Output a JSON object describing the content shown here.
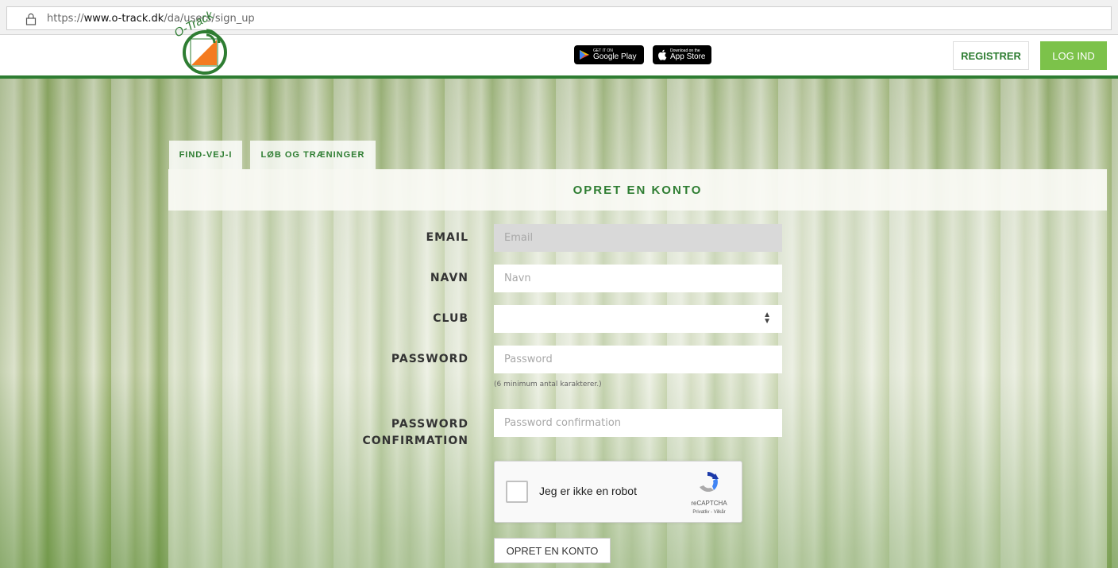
{
  "browser": {
    "url_prefix": "https://",
    "url_domain": "www.o-track.dk",
    "url_path": "/da/users/sign_up"
  },
  "header": {
    "logo_text": "O-Track",
    "google_play_small": "GET IT ON",
    "google_play_big": "Google Play",
    "app_store_small": "Download on the",
    "app_store_big": "App Store",
    "register_label": "REGISTRER",
    "login_label": "LOG IND"
  },
  "tabs": [
    {
      "label": "FIND-VEJ-I"
    },
    {
      "label": "LØB OG TRÆNINGER"
    }
  ],
  "form": {
    "title": "OPRET EN KONTO",
    "email_label": "EMAIL",
    "email_placeholder": "Email",
    "name_label": "NAVN",
    "name_placeholder": "Navn",
    "club_label": "CLUB",
    "club_value": "",
    "password_label": "PASSWORD",
    "password_placeholder": "Password",
    "password_hint": "(6 minimum antal karakterer.)",
    "password_confirmation_label_1": "PASSWORD",
    "password_confirmation_label_2": "CONFIRMATION",
    "password_confirmation_placeholder": "Password confirmation",
    "submit_label": "OPRET EN KONTO"
  },
  "captcha": {
    "label": "Jeg er ikke en robot",
    "brand": "reCAPTCHA",
    "links": "Privatliv - Vilkår"
  },
  "colors": {
    "brand_green": "#2e7d32",
    "login_green": "#7cc24a",
    "logo_orange": "#f47b20"
  }
}
